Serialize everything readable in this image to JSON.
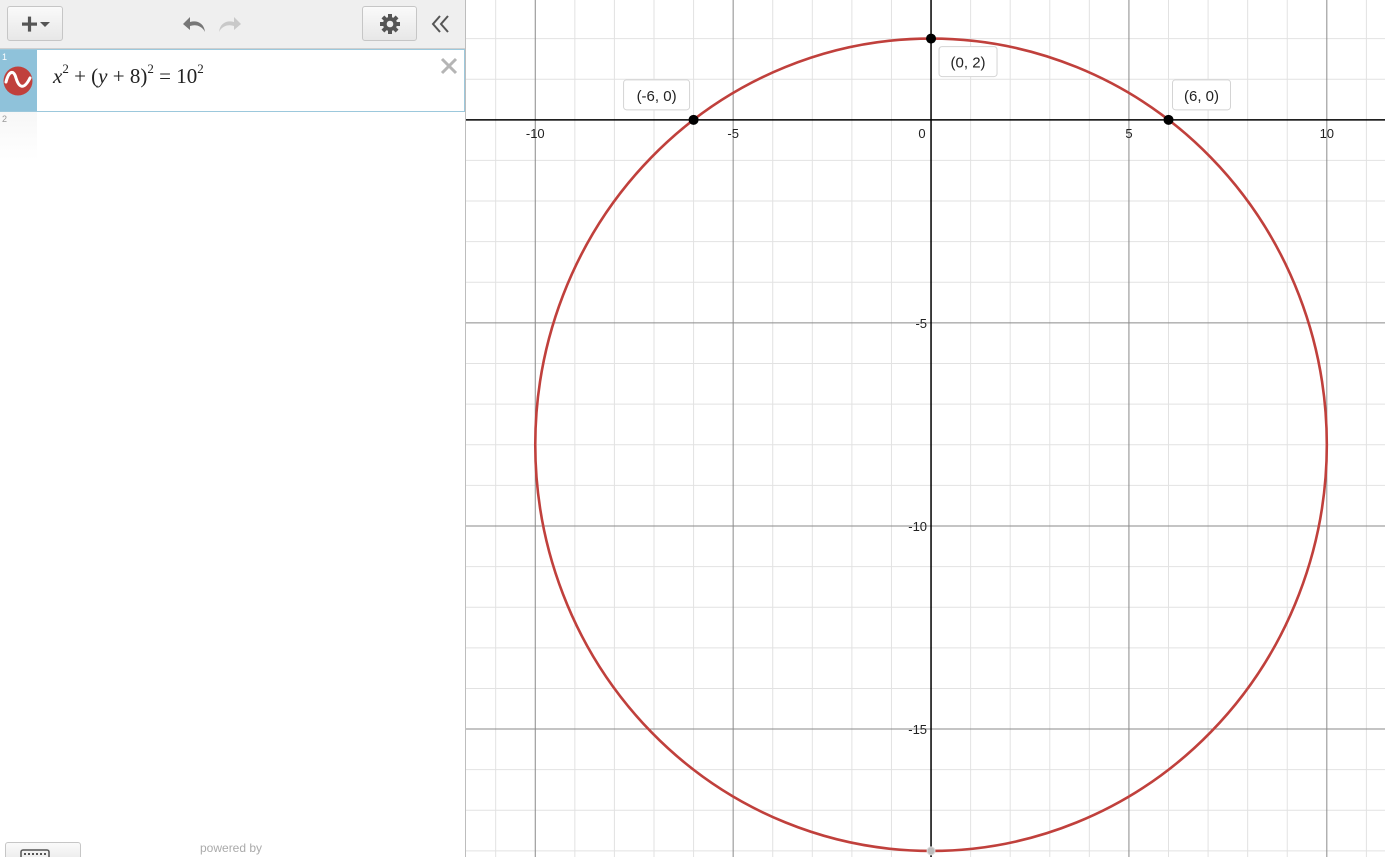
{
  "toolbar": {
    "add_icon": "plus-caret-icon",
    "undo_icon": "undo-arrow-icon",
    "redo_icon": "redo-arrow-icon",
    "settings_icon": "gear-icon",
    "collapse_icon": "double-chevron-left-icon"
  },
  "expressions": [
    {
      "index": "1",
      "color": "#c0403c",
      "latex_text": "x^2 + (y + 8)^2 = 10^2",
      "parts": {
        "x": "x",
        "plus1": "+",
        "lp": "(",
        "y": "y",
        "plus2": "+",
        "eight": "8",
        "rp": ")",
        "eq": "=",
        "ten": "10",
        "exp": "2"
      }
    },
    {
      "index": "2"
    }
  ],
  "footer": {
    "powered_by": "powered by",
    "keyboard_icon": "keyboard-icon"
  },
  "colors": {
    "curve": "#c0403c",
    "axis": "#000000",
    "grid_major": "#8a8a8a",
    "grid_minor": "#e2e2e2",
    "point": "#000000"
  },
  "chart_data": {
    "type": "scatter",
    "title": "",
    "xlim": [
      -11.75,
      11.47
    ],
    "ylim": [
      -18.15,
      2.95
    ],
    "major_step": 5,
    "minor_step": 1,
    "grid": true,
    "x_ticks": [
      "-10",
      "-5",
      "0",
      "5",
      "10"
    ],
    "y_ticks": [
      "-5",
      "-10",
      "-15"
    ],
    "curve": {
      "kind": "circle",
      "cx": 0,
      "cy": -8,
      "r": 10,
      "color": "#c0403c"
    },
    "points": [
      {
        "x": -6,
        "y": 0,
        "label": "(-6, 0)",
        "label_side": "upper-left"
      },
      {
        "x": 0,
        "y": 2,
        "label": "(0, 2)",
        "label_side": "lower-right"
      },
      {
        "x": 6,
        "y": 0,
        "label": "(6, 0)",
        "label_side": "upper-right"
      },
      {
        "x": 0,
        "y": -18,
        "label": "",
        "style": "hollow-gray"
      }
    ]
  }
}
